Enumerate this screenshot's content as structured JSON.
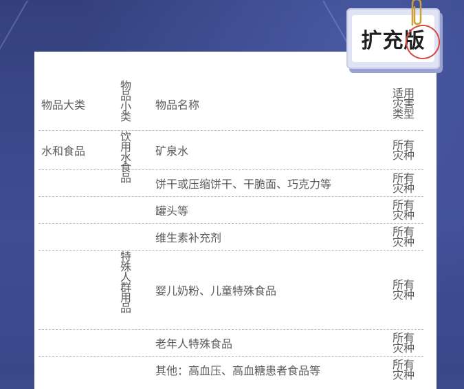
{
  "badge": {
    "label": "扩充版"
  },
  "table": {
    "headers": {
      "major": "物品大类",
      "minor": "物品小类",
      "name": "物品名称",
      "type": "适用灾害类型"
    },
    "groups": [
      {
        "major": "水和食品",
        "minor": "饮用水食品"
      },
      {
        "minor": "特殊人群用品"
      }
    ],
    "rows": [
      {
        "name": "矿泉水",
        "type": "所有灾种"
      },
      {
        "name": "饼干或压缩饼干、干脆面、巧克力等",
        "type": "所有灾种"
      },
      {
        "name": "罐头等",
        "type": "所有灾种"
      },
      {
        "name": "维生素补充剂",
        "type": "所有灾种"
      },
      {
        "name": "婴儿奶粉、儿童特殊食品",
        "type": "所有灾种"
      },
      {
        "name": "老年人特殊食品",
        "type": "所有灾种"
      },
      {
        "name": "其他：高血压、高血糖患者食品等",
        "type": "所有灾种"
      }
    ]
  },
  "colors": {
    "background": "#3d4a8c",
    "text": "#5a5a5a",
    "divider": "#b9bcc8",
    "circle": "#d9463f"
  }
}
